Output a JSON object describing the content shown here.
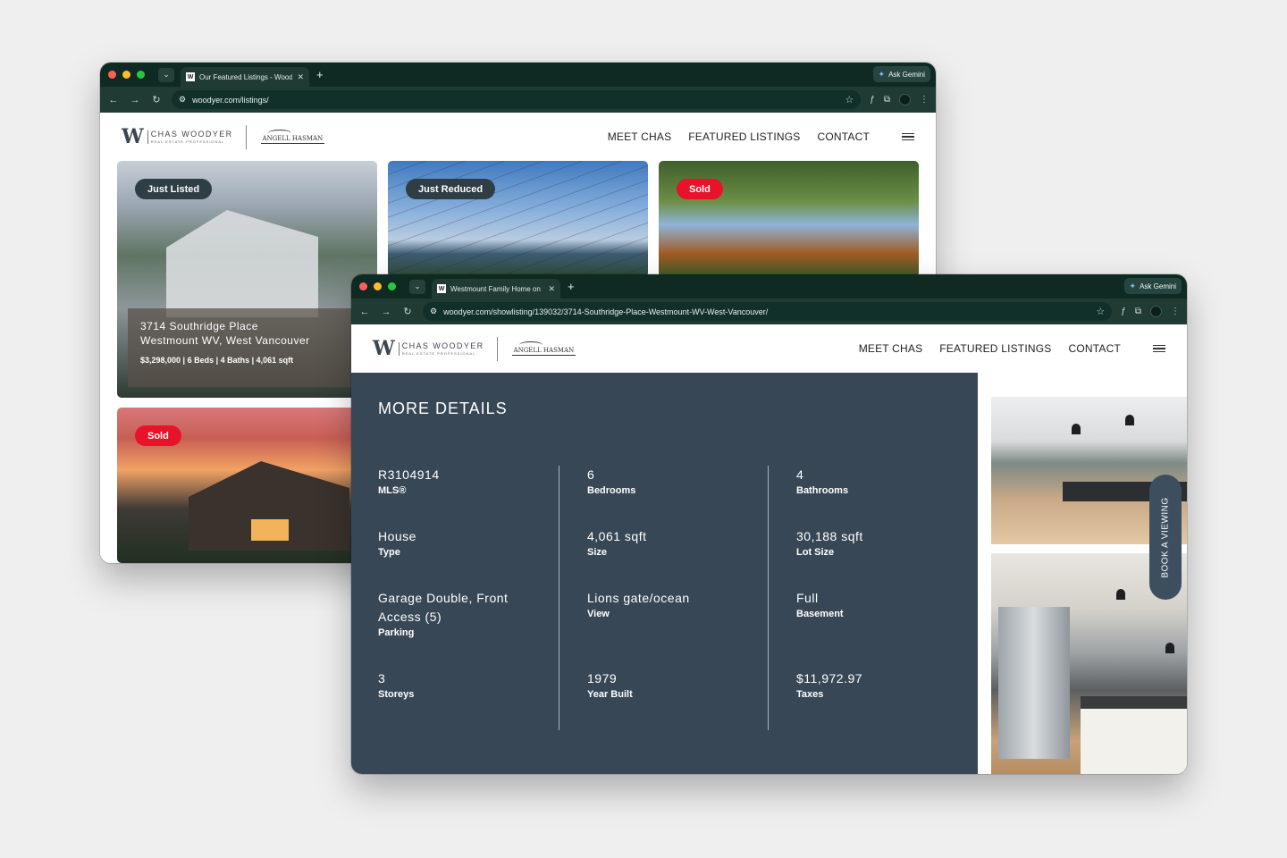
{
  "back_window": {
    "tab_title": "Our Featured Listings - Woodyer",
    "favicon": "W",
    "url": "woodyer.com/listings/",
    "gemini_label": "Ask Gemini",
    "nav": [
      "MEET CHAS",
      "FEATURED LISTINGS",
      "CONTACT"
    ],
    "logo_name": "CHAS WOODYER",
    "logo_sub": "REAL ESTATE PROFESSIONAL",
    "partner": "ANGELL HASMAN",
    "cards": [
      {
        "badge": "Just Listed",
        "address1": "3714 Southridge Place",
        "address2": "Westmount WV, West Vancouver",
        "meta": "$3,298,000 | 6 Beds | 4 Baths | 4,061 sqft"
      },
      {
        "badge": "Just Reduced"
      },
      {
        "badge": "Sold"
      },
      {
        "badge": "Sold"
      }
    ]
  },
  "front_window": {
    "tab_title": "Westmount Family Home on",
    "favicon": "W",
    "url": "woodyer.com/showlisting/139032/3714-Southridge-Place-Westmount-WV-West-Vancouver/",
    "gemini_label": "Ask Gemini",
    "nav": [
      "MEET CHAS",
      "FEATURED LISTINGS",
      "CONTACT"
    ],
    "logo_name": "CHAS WOODYER",
    "logo_sub": "REAL ESTATE PROFESSIONAL",
    "partner": "ANGELL HASMAN",
    "details_title": "MORE DETAILS",
    "details": [
      {
        "value": "R3104914",
        "label": "MLS®"
      },
      {
        "value": "6",
        "label": "Bedrooms"
      },
      {
        "value": "4",
        "label": "Bathrooms"
      },
      {
        "value": "House",
        "label": "Type"
      },
      {
        "value": "4,061 sqft",
        "label": "Size"
      },
      {
        "value": "30,188 sqft",
        "label": "Lot Size"
      },
      {
        "value": "Garage Double, Front Access (5)",
        "label": "Parking"
      },
      {
        "value": "Lions gate/ocean",
        "label": "View"
      },
      {
        "value": "Full",
        "label": "Basement"
      },
      {
        "value": "3",
        "label": "Storeys"
      },
      {
        "value": "1979",
        "label": "Year Built"
      },
      {
        "value": "$11,972.97",
        "label": "Taxes"
      }
    ],
    "book_button": "BOOK A VIEWING"
  }
}
